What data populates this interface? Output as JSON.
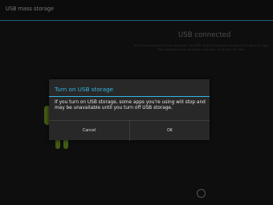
{
  "action_bar": {
    "title": "USB mass storage"
  },
  "status": {
    "heading": "USB connected",
    "body": "You're connected to your computer via USB. Touch the button below if you want to copy files between your computer and your Android's SD card."
  },
  "dialog": {
    "title": "Turn on USB storage",
    "message": "If you turn on USB storage, some apps you're using will stop and may be unavailable until you turn off USB storage.",
    "cancel_label": "Cancel",
    "ok_label": "OK"
  },
  "colors": {
    "accent": "#33b5e5",
    "android_green": "#7aa51f"
  },
  "icons": {
    "android": "android-robot-icon",
    "spinner": "loading-spinner-icon"
  }
}
